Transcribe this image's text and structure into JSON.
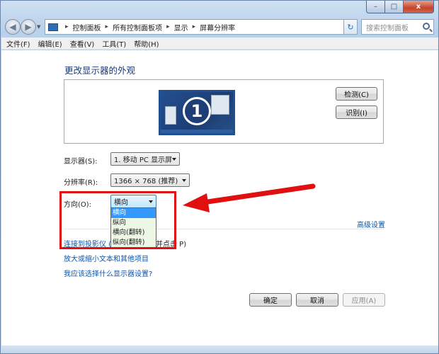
{
  "window": {
    "min_glyph": "–",
    "max_glyph": "□",
    "close_glyph": "x"
  },
  "nav": {
    "back_glyph": "◀",
    "fwd_glyph": "▶",
    "breadcrumbs": [
      "控制面板",
      "所有控制面板项",
      "显示",
      "屏幕分辨率"
    ],
    "refresh_glyph": "↻",
    "search_placeholder": "搜索控制面板"
  },
  "menu": [
    "文件(F)",
    "编辑(E)",
    "查看(V)",
    "工具(T)",
    "帮助(H)"
  ],
  "main": {
    "heading": "更改显示器的外观",
    "monitor_number": "1",
    "detect_label": "检测(C)",
    "identify_label": "识别(I)",
    "display_label": "显示器(S):",
    "display_value": "1. 移动 PC 显示屏",
    "resolution_label": "分辨率(R):",
    "resolution_value": "1366 × 768 (推荐)",
    "orientation_label": "方向(O):",
    "orientation_value": "横向",
    "orientation_options": [
      "横向",
      "纵向",
      "横向(翻转)",
      "纵向(翻转)"
    ],
    "advanced_link": "高级设置",
    "projector_link": "连接到投影仪 (",
    "projector_tail": "并点击 P)",
    "text_size_link": "放大或缩小文本和其他项目",
    "which_settings_link": "我应该选择什么显示器设置?"
  },
  "buttons": {
    "ok": "确定",
    "cancel": "取消",
    "apply": "应用(A)"
  },
  "colors": {
    "annotation": "#e01010",
    "link": "#0f55aa",
    "heading": "#1c3a73",
    "selected": "#3399ff"
  }
}
